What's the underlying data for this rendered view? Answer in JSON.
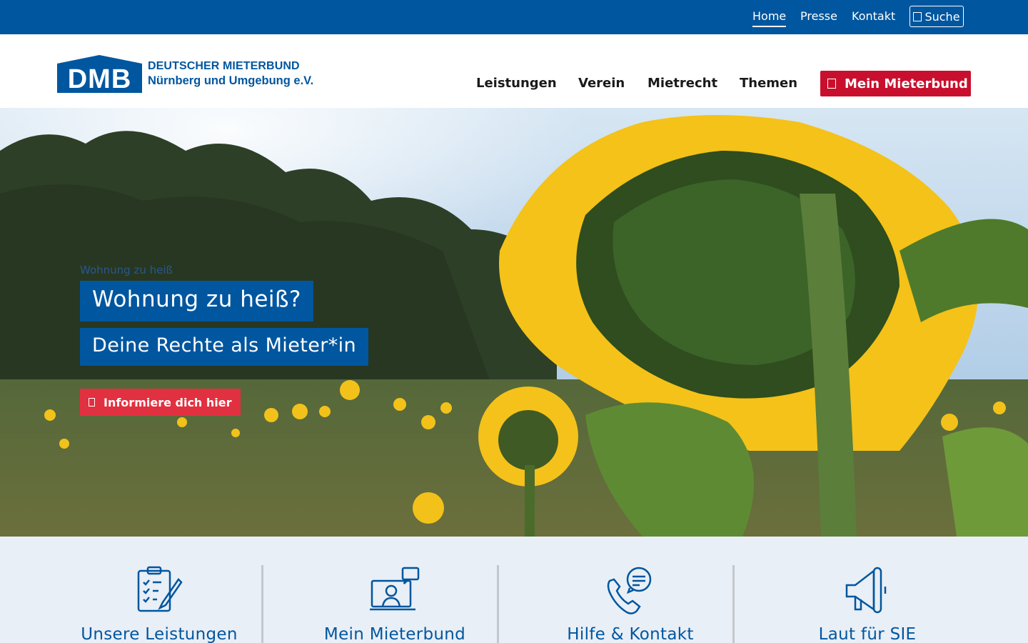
{
  "topbar": {
    "home": "Home",
    "presse": "Presse",
    "kontakt": "Kontakt",
    "search": "Suche",
    "search_icon": "search-icon"
  },
  "logo": {
    "mark": "DMB",
    "line1": "DEUTSCHER MIETERBUND",
    "line2": "Nürnberg und Umgebung e.V."
  },
  "nav": {
    "items": [
      "Leistungen",
      "Verein",
      "Mietrecht",
      "Themen"
    ],
    "cta": "Mein Mieterbund",
    "cta_icon": "lock-icon"
  },
  "hero": {
    "kicker": "Wohnung zu heiß",
    "title": "Wohnung zu heiß?",
    "subtitle": "Deine Rechte als Mieter*in",
    "cta": "Informiere dich hier",
    "cta_icon": "chevron-right-icon"
  },
  "features": [
    {
      "label": "Unsere Leistungen",
      "icon": "clipboard-pen-icon"
    },
    {
      "label": "Mein Mieterbund",
      "icon": "person-laptop-chat-icon"
    },
    {
      "label": "Hilfe & Kontakt",
      "icon": "phone-chat-icon"
    },
    {
      "label": "Laut für SIE",
      "icon": "megaphone-icon"
    }
  ],
  "colors": {
    "brand_blue": "#00569f",
    "brand_red": "#c8102e",
    "cta_red": "#e1303f",
    "feature_bg": "#e9eff6"
  }
}
